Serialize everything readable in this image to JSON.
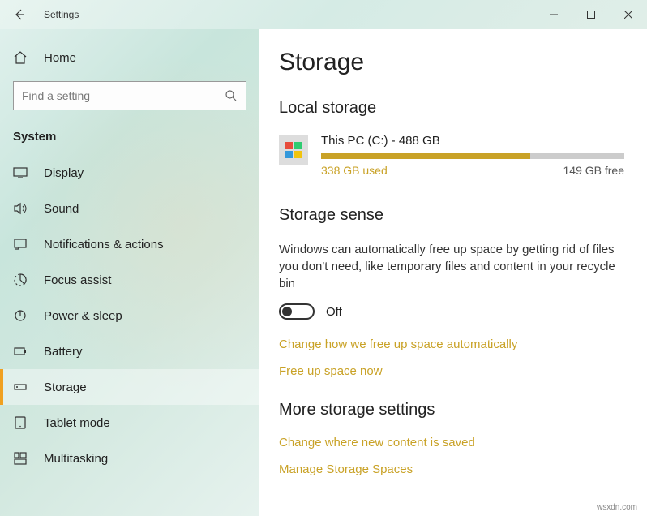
{
  "titlebar": {
    "title": "Settings"
  },
  "home": {
    "label": "Home"
  },
  "search": {
    "placeholder": "Find a setting"
  },
  "sectionLabel": "System",
  "nav": [
    {
      "label": "Display"
    },
    {
      "label": "Sound"
    },
    {
      "label": "Notifications & actions"
    },
    {
      "label": "Focus assist"
    },
    {
      "label": "Power & sleep"
    },
    {
      "label": "Battery"
    },
    {
      "label": "Storage"
    },
    {
      "label": "Tablet mode"
    },
    {
      "label": "Multitasking"
    }
  ],
  "page": {
    "title": "Storage",
    "localStorageHead": "Local storage",
    "drive": {
      "name": "This PC (C:) - 488 GB",
      "used": "338 GB used",
      "free": "149 GB free"
    },
    "storageSenseHead": "Storage sense",
    "storageSenseDesc": "Windows can automatically free up space by getting rid of files you don't need, like temporary files and content in your recycle bin",
    "toggleLabel": "Off",
    "linkChangeHow": "Change how we free up space automatically",
    "linkFreeUp": "Free up space now",
    "moreHead": "More storage settings",
    "linkChangeWhere": "Change where new content is saved",
    "linkManageSpaces": "Manage Storage Spaces"
  },
  "watermark": "wsxdn.com"
}
